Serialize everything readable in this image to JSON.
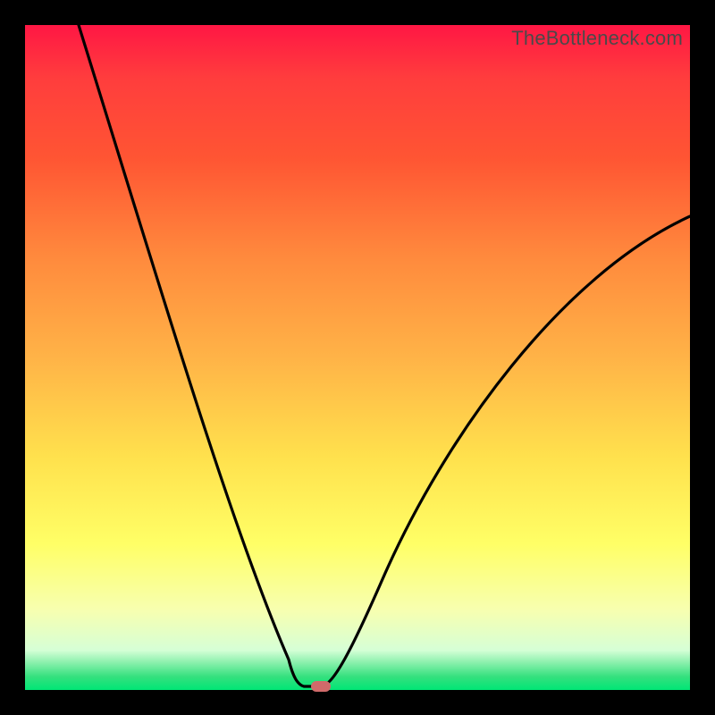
{
  "watermark": "TheBottleneck.com",
  "chart_data": {
    "type": "line",
    "title": "",
    "xlabel": "",
    "ylabel": "",
    "xlim": [
      0,
      1
    ],
    "ylim": [
      0,
      100
    ],
    "curve": {
      "left_start": {
        "x": 0.08,
        "y": 100
      },
      "minimum": {
        "x": 0.42,
        "y": 0
      },
      "right_end": {
        "x": 1.0,
        "y": 71
      }
    },
    "marker": {
      "x": 0.445,
      "y": 0
    },
    "colors": {
      "gradient_top": "#ff1744",
      "gradient_mid_upper": "#ff8a3d",
      "gradient_mid": "#ffe14d",
      "gradient_lower": "#f7ffb0",
      "gradient_bottom": "#00e676",
      "curve": "#000000",
      "marker": "#d06a6a",
      "frame": "#000000"
    }
  }
}
